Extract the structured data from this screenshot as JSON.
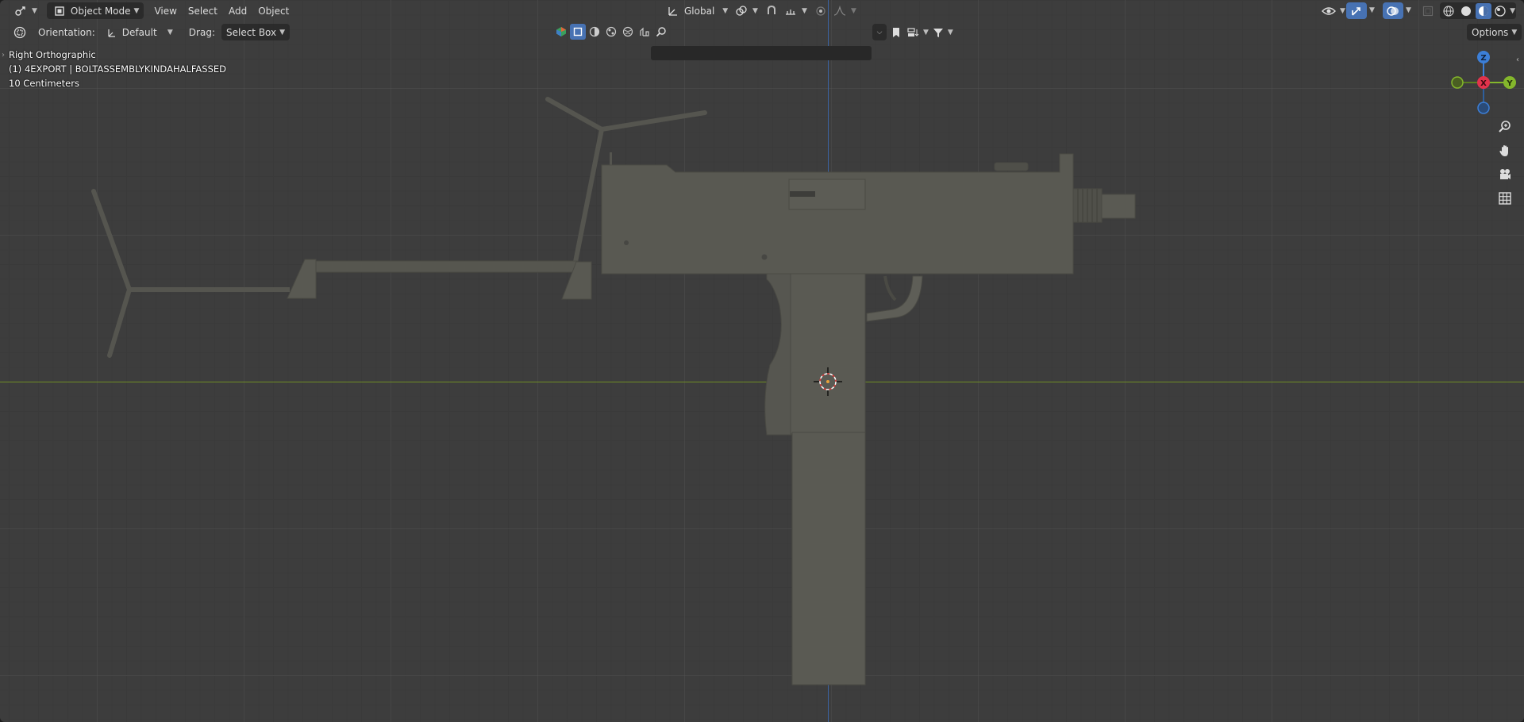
{
  "header": {
    "mode_label": "Object Mode",
    "menus": [
      "View",
      "Select",
      "Add",
      "Object"
    ],
    "transform_orientation": "Global"
  },
  "tool_settings": {
    "orientation_label": "Orientation:",
    "orientation_value": "Default",
    "drag_label": "Drag:",
    "drag_value": "Select Box",
    "options_label": "Options",
    "search_placeholder": ""
  },
  "viewport_info": {
    "view_name": "Right Orthographic",
    "object_info": "(1) 4EXPORT | BOLTASSEMBLYKINDAHALFASSED",
    "scale_info": "10 Centimeters"
  },
  "gizmo": {
    "z_label": "Z",
    "x_label": "X",
    "y_label": "Y"
  },
  "colors": {
    "viewport_bg": "#3d3d3d",
    "y_axis": "#6f8d24",
    "z_axis": "#3c64a4",
    "model": "#595952",
    "active_button": "#4772b3",
    "gizmo_x": "#e2334c",
    "gizmo_y": "#84b72c",
    "gizmo_z": "#3c7fd8"
  },
  "icons": [
    "editor-type-icon",
    "object-mode-icon",
    "orientation-axis-icon",
    "pivot-icon",
    "snap-icon",
    "proportional-edit-icon",
    "transform-gizmo-icon",
    "selectability-icon",
    "visibility-icon",
    "overlay-icon",
    "xray-icon",
    "wireframe-shading-icon",
    "solid-shading-icon",
    "material-shading-icon",
    "rendered-shading-icon",
    "zoom-icon",
    "hand-pan-icon",
    "camera-icon",
    "grid-view-icon"
  ]
}
